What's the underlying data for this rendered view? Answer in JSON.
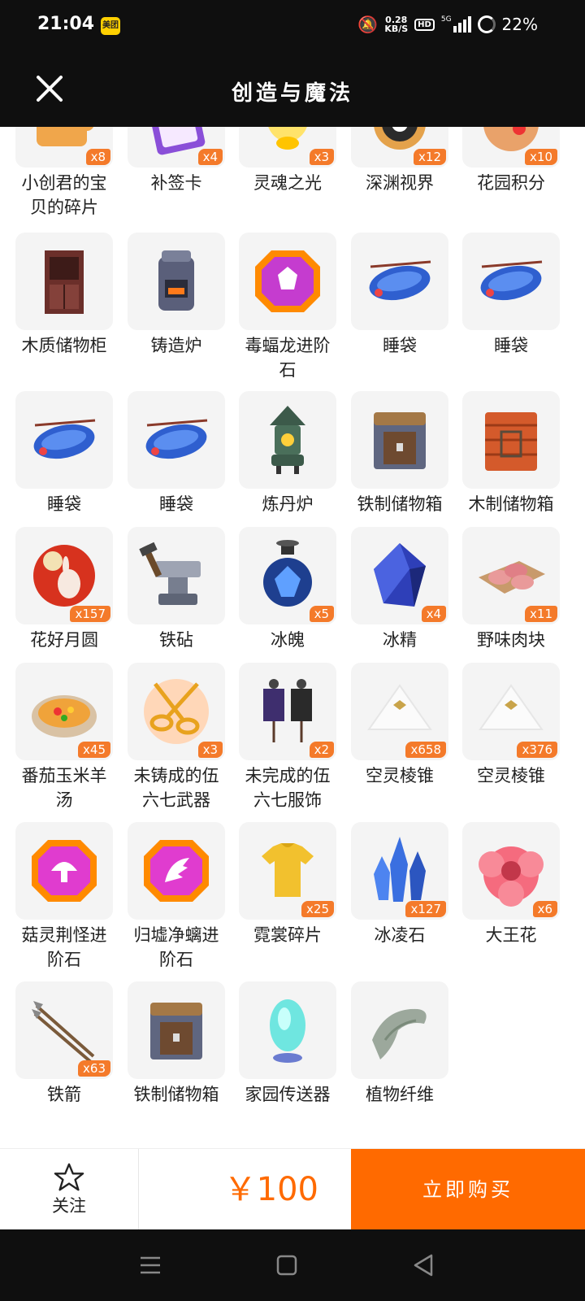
{
  "status_bar": {
    "time": "21:04",
    "app_badge": "美团",
    "net_speed_value": "0.28",
    "net_speed_unit": "KB/S",
    "hd": "HD",
    "network": "5G",
    "battery": "22%"
  },
  "header": {
    "title": "创造与魔法"
  },
  "items": [
    {
      "label": "小创君的宝贝的碎片",
      "count": "x8",
      "icon": "puzzle-icon"
    },
    {
      "label": "补签卡",
      "count": "x4",
      "icon": "card-icon"
    },
    {
      "label": "灵魂之光",
      "count": "x3",
      "icon": "lantern-icon"
    },
    {
      "label": "深渊视界",
      "count": "x12",
      "icon": "eye-icon"
    },
    {
      "label": "花园积分",
      "count": "x10",
      "icon": "cookie-icon"
    },
    {
      "label": "木质储物柜",
      "count": "",
      "icon": "cabinet-icon"
    },
    {
      "label": "铸造炉",
      "count": "",
      "icon": "furnace-icon"
    },
    {
      "label": "毒蝠龙进阶石",
      "count": "",
      "icon": "gem-icon"
    },
    {
      "label": "睡袋",
      "count": "",
      "icon": "sleeping-bag-icon"
    },
    {
      "label": "睡袋",
      "count": "",
      "icon": "sleeping-bag-icon"
    },
    {
      "label": "睡袋",
      "count": "",
      "icon": "sleeping-bag-icon"
    },
    {
      "label": "睡袋",
      "count": "",
      "icon": "sleeping-bag-icon"
    },
    {
      "label": "炼丹炉",
      "count": "",
      "icon": "alchemy-furnace-icon"
    },
    {
      "label": "铁制储物箱",
      "count": "",
      "icon": "iron-chest-icon"
    },
    {
      "label": "木制储物箱",
      "count": "",
      "icon": "wooden-chest-icon"
    },
    {
      "label": "花好月圆",
      "count": "x157",
      "icon": "moon-rabbit-icon"
    },
    {
      "label": "铁砧",
      "count": "",
      "icon": "anvil-icon"
    },
    {
      "label": "冰魄",
      "count": "x5",
      "icon": "potion-icon"
    },
    {
      "label": "冰精",
      "count": "x4",
      "icon": "crystal-icon"
    },
    {
      "label": "野味肉块",
      "count": "x11",
      "icon": "meat-icon"
    },
    {
      "label": "番茄玉米羊汤",
      "count": "x45",
      "icon": "soup-icon"
    },
    {
      "label": "未铸成的伍六七武器",
      "count": "x3",
      "icon": "scissors-icon"
    },
    {
      "label": "未完成的伍六七服饰",
      "count": "x2",
      "icon": "mannequin-icon"
    },
    {
      "label": "空灵棱锥",
      "count": "x658",
      "icon": "pyramid-icon"
    },
    {
      "label": "空灵棱锥",
      "count": "x376",
      "icon": "pyramid-icon"
    },
    {
      "label": "菇灵荆怪进阶石",
      "count": "",
      "icon": "mushroom-gem-icon"
    },
    {
      "label": "归墟净螭进阶石",
      "count": "",
      "icon": "dragon-gem-icon"
    },
    {
      "label": "霓裳碎片",
      "count": "x25",
      "icon": "shirt-icon"
    },
    {
      "label": "冰凌石",
      "count": "x127",
      "icon": "ice-crystal-icon"
    },
    {
      "label": "大王花",
      "count": "x6",
      "icon": "flower-icon"
    },
    {
      "label": "铁箭",
      "count": "x63",
      "icon": "arrows-icon"
    },
    {
      "label": "铁制储物箱",
      "count": "",
      "icon": "iron-chest-icon"
    },
    {
      "label": "家园传送器",
      "count": "",
      "icon": "teleporter-icon"
    },
    {
      "label": "植物纤维",
      "count": "",
      "icon": "fiber-icon"
    }
  ],
  "bottom": {
    "follow_label": "关注",
    "price": "￥100",
    "buy_label": "立即购买"
  },
  "colors": {
    "accent": "#ff6a00",
    "badge": "#f47a2a",
    "bar": "#0f0f0f"
  }
}
